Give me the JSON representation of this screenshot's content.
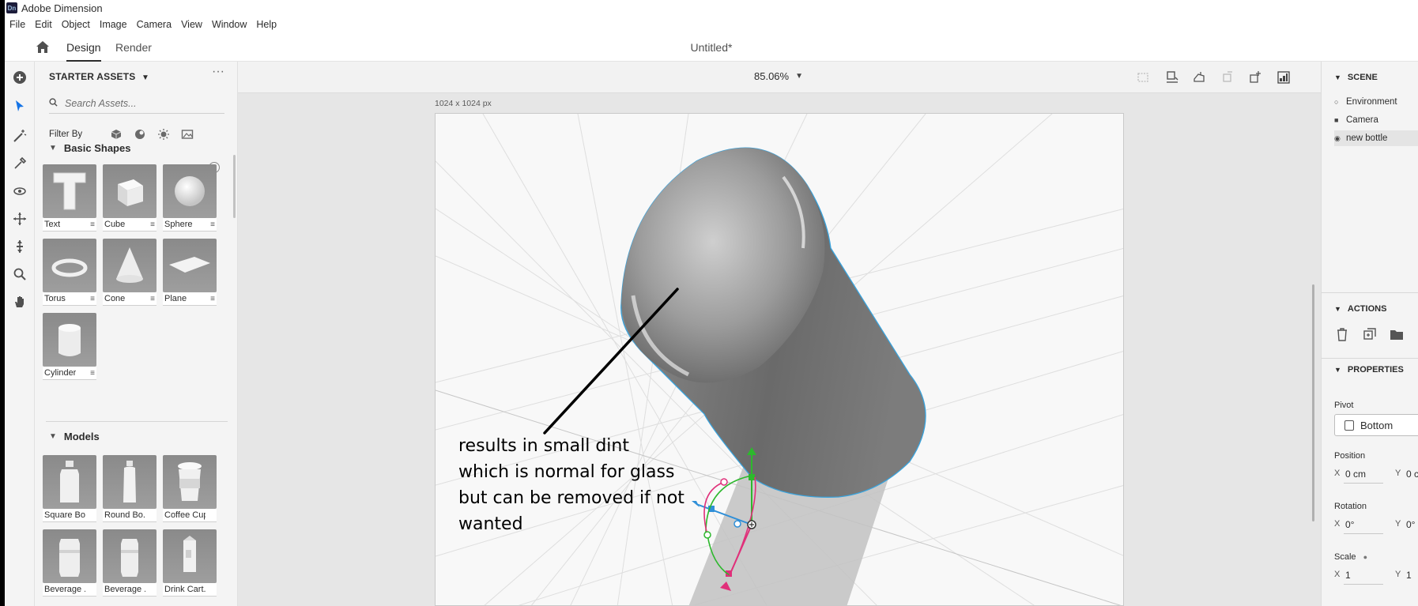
{
  "app": {
    "title": "Adobe Dimension",
    "logo_text": "Dn"
  },
  "menu": [
    "File",
    "Edit",
    "Object",
    "Image",
    "Camera",
    "View",
    "Window",
    "Help"
  ],
  "topbar": {
    "tabs": [
      "Design",
      "Render"
    ],
    "doc_title": "Untitled*"
  },
  "assets": {
    "header": "STARTER ASSETS",
    "search_placeholder": "Search Assets...",
    "filter_label": "Filter By",
    "sections": [
      {
        "title": "Basic Shapes",
        "items": [
          "Text",
          "Cube",
          "Sphere",
          "Torus",
          "Cone",
          "Plane",
          "Cylinder"
        ]
      },
      {
        "title": "Models",
        "items": [
          "Square Bo...",
          "Round Bo...",
          "Coffee Cup",
          "Beverage ...",
          "Beverage ...",
          "Drink Cart..."
        ]
      }
    ]
  },
  "viewport": {
    "zoom": "85.06%",
    "canvas_size": "1024 x 1024 px",
    "annotation": [
      "results in small dint",
      "which is normal for glass",
      "but can be removed if not",
      "wanted"
    ]
  },
  "right_panel": {
    "scene_title": "SCENE",
    "scene_items": [
      "Environment",
      "Camera",
      "new bottle"
    ],
    "actions_title": "ACTIONS",
    "properties_title": "PROPERTIES",
    "pivot_label": "Pivot",
    "pivot_value": "Bottom",
    "position_label": "Position",
    "position": {
      "x_axis": "X",
      "x": "0 cm",
      "y_axis": "Y",
      "y": "0 c"
    },
    "rotation_label": "Rotation",
    "rotation": {
      "x_axis": "X",
      "x": "0°",
      "y_axis": "Y",
      "y": "0°"
    },
    "scale_label": "Scale",
    "scale": {
      "x_axis": "X",
      "x": "1",
      "y_axis": "Y",
      "y": "1"
    }
  },
  "colors": {
    "accent": "#1473e6",
    "gizmo_green": "#2db82d",
    "gizmo_pink": "#e0307a",
    "gizmo_blue": "#2f8fd8",
    "selection_outline": "#3aa0d8"
  }
}
